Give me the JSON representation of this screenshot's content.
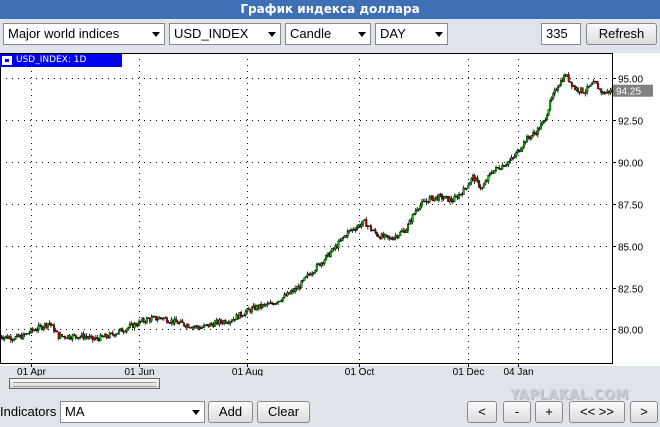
{
  "title": "График индекса доллара",
  "toolbar": {
    "market": "Major world indices",
    "symbol": "USD_INDEX",
    "chart_type": "Candle",
    "period": "DAY",
    "bars": "335",
    "refresh_label": "Refresh"
  },
  "chart_label": "USD_INDEX: 1D",
  "price_tag": "94.25",
  "watermark": "YAPLAKAL.COM",
  "bottom": {
    "indicators_label": "Indicators",
    "indicator_value": "MA",
    "add_label": "Add",
    "clear_label": "Clear",
    "nav": [
      "<",
      "-",
      "+",
      "<< >>",
      ">"
    ]
  },
  "colors": {
    "title_bg": "#3f6fb5",
    "label_bg": "#0000ee",
    "up_candle": "#00cc00",
    "down_candle": "#cc0000",
    "price_tag_bg": "#808080"
  },
  "chart_data": {
    "type": "candlestick",
    "title": "",
    "y_ticks": [
      "80.00",
      "82.50",
      "85.00",
      "87.50",
      "90.00",
      "92.50",
      "95.00"
    ],
    "y_range": [
      78.0,
      96.5
    ],
    "x_ticks": [
      "01 Apr",
      "01 Jun",
      "01 Aug",
      "01 Oct",
      "01 Dec",
      "04 Jan"
    ],
    "x_tick_index": [
      20,
      90,
      160,
      232,
      303,
      335
    ],
    "last_close": 94.25,
    "close_series": [
      [
        0,
        79.6
      ],
      [
        10,
        79.5
      ],
      [
        15,
        79.6
      ],
      [
        20,
        79.9
      ],
      [
        25,
        80.1
      ],
      [
        32,
        80.4
      ],
      [
        38,
        79.6
      ],
      [
        45,
        79.6
      ],
      [
        55,
        79.6
      ],
      [
        60,
        79.4
      ],
      [
        70,
        79.6
      ],
      [
        80,
        80.0
      ],
      [
        90,
        80.4
      ],
      [
        95,
        80.6
      ],
      [
        105,
        80.7
      ],
      [
        115,
        80.4
      ],
      [
        120,
        80.3
      ],
      [
        130,
        80.1
      ],
      [
        140,
        80.4
      ],
      [
        150,
        80.6
      ],
      [
        158,
        81.0
      ],
      [
        165,
        81.3
      ],
      [
        175,
        81.5
      ],
      [
        185,
        82.0
      ],
      [
        193,
        82.5
      ],
      [
        200,
        83.3
      ],
      [
        210,
        84.2
      ],
      [
        218,
        85.0
      ],
      [
        225,
        85.8
      ],
      [
        232,
        86.2
      ],
      [
        236,
        86.4
      ],
      [
        240,
        86.0
      ],
      [
        245,
        85.6
      ],
      [
        252,
        85.4
      ],
      [
        258,
        85.7
      ],
      [
        263,
        86.0
      ],
      [
        270,
        87.3
      ],
      [
        278,
        87.8
      ],
      [
        285,
        87.9
      ],
      [
        293,
        87.7
      ],
      [
        300,
        88.3
      ],
      [
        306,
        89.1
      ],
      [
        312,
        88.4
      ],
      [
        318,
        89.4
      ],
      [
        325,
        89.8
      ],
      [
        332,
        90.2
      ],
      [
        340,
        91.3
      ],
      [
        347,
        91.8
      ],
      [
        352,
        92.4
      ],
      [
        356,
        93.5
      ],
      [
        361,
        94.6
      ],
      [
        366,
        95.2
      ],
      [
        372,
        94.4
      ],
      [
        378,
        94.2
      ],
      [
        385,
        94.7
      ],
      [
        390,
        94.1
      ],
      [
        396,
        94.25
      ]
    ]
  }
}
